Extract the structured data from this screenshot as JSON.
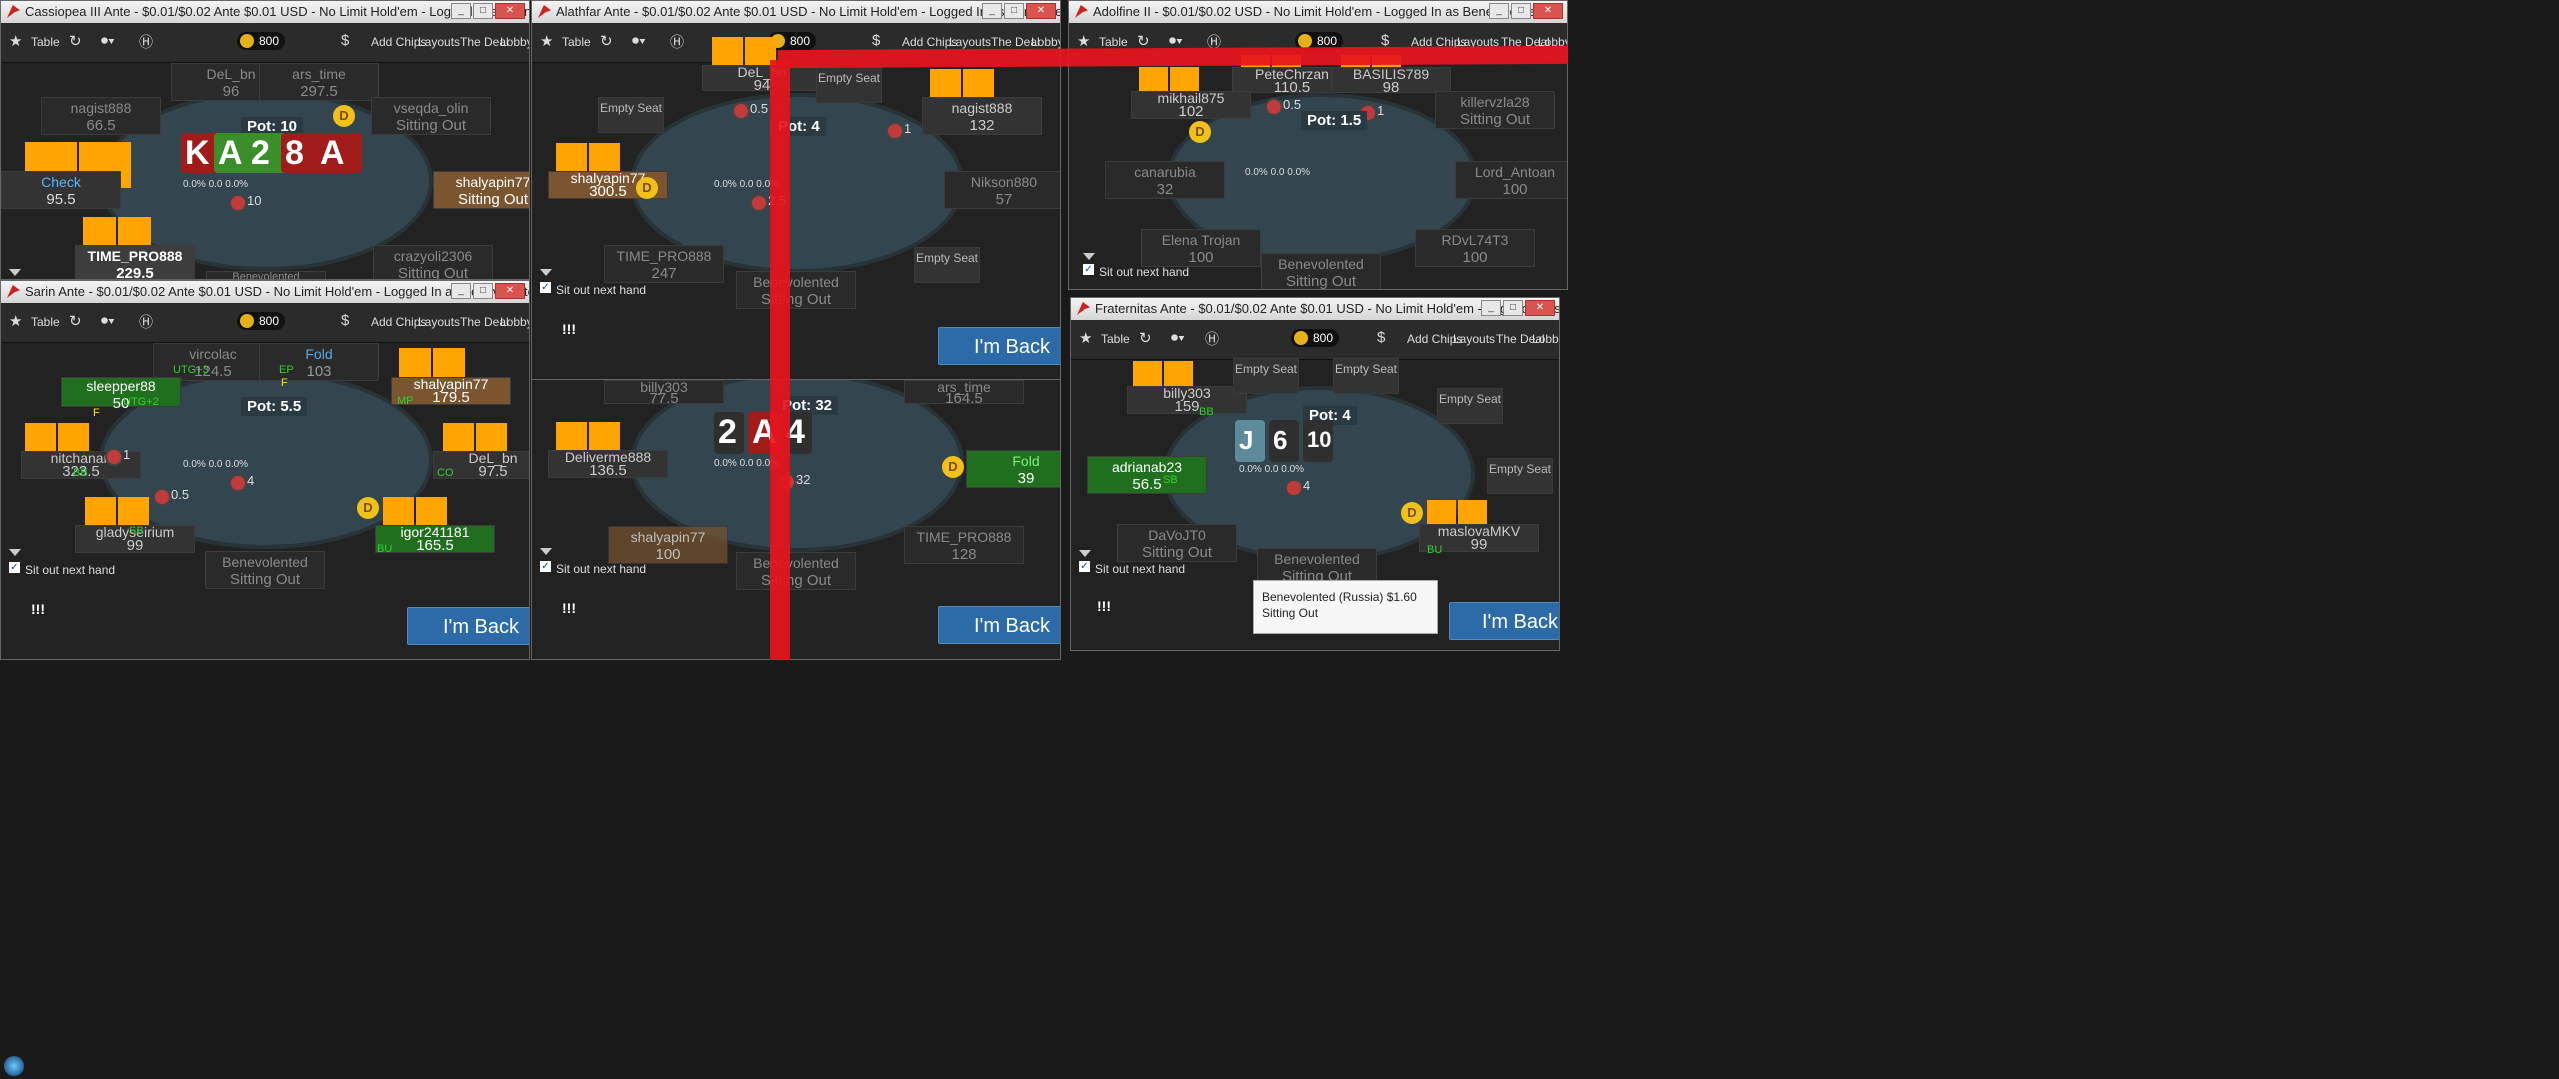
{
  "windows": [
    {
      "id": "w1",
      "title": "Cassiopea III Ante - $0.01/$0.02 Ante $0.01 USD - No Limit Hold'em - Logged In as Benevolented",
      "pot": "Pot: 10",
      "seats": [
        {
          "name": "DeL_bn",
          "stack": "96"
        },
        {
          "name": "ars_time",
          "stack": "297.5"
        },
        {
          "name": "nagist888",
          "stack": "66.5"
        },
        {
          "name": "vseqda_olin",
          "stack": "Sitting Out"
        },
        {
          "name": "Check",
          "stack": "95.5"
        },
        {
          "name": "shalyapin77",
          "stack": "Sitting Out"
        },
        {
          "name": "TIME_PRO888",
          "stack": "229.5"
        },
        {
          "name": "crazyoli2306",
          "stack": "Sitting Out"
        },
        {
          "name": "Benevolented",
          "stack": ""
        }
      ],
      "board": [
        "K",
        "A",
        "2",
        "8",
        "A"
      ],
      "betcenter": "10",
      "stats": "0.0% 0.0 0.0%"
    },
    {
      "id": "w2",
      "title": "Alathfar Ante - $0.01/$0.02 Ante $0.01 USD - No Limit Hold'em - Logged In as Benevolented",
      "pot": "Pot: 4",
      "seats": [
        {
          "name": "DeL_bn",
          "stack": "94"
        },
        {
          "name": "nagist888",
          "stack": "132"
        },
        {
          "name": "shalyapin77",
          "stack": "300.5"
        },
        {
          "name": "Nikson880",
          "stack": "57"
        },
        {
          "name": "TIME_PRO888",
          "stack": "247"
        },
        {
          "name": "Benevolented",
          "stack": "Sitting Out"
        }
      ],
      "empty": [
        "Empty Seat",
        "Empty Seat",
        "Empty Seat"
      ],
      "bets": [
        "0.5",
        "1",
        "2.5"
      ],
      "stats": "0.0% 0.0 0.0%",
      "sitout": "Sit out next hand",
      "imback": "I'm Back",
      "side": "!!!"
    },
    {
      "id": "w3",
      "title": "Adolfine II - $0.01/$0.02 USD - No Limit Hold'em - Logged In as Benevolented",
      "pot": "Pot: 1.5",
      "seats": [
        {
          "name": "PeteChrzan",
          "stack": "110.5"
        },
        {
          "name": "BASILIS789",
          "stack": "98"
        },
        {
          "name": "mikhail875",
          "stack": "102"
        },
        {
          "name": "killervzla28",
          "stack": "Sitting Out"
        },
        {
          "name": "canarubia",
          "stack": "32"
        },
        {
          "name": "Lord_Antoan",
          "stack": "100"
        },
        {
          "name": "Elena Trojan",
          "stack": "100"
        },
        {
          "name": "RDvL74T3",
          "stack": "100"
        },
        {
          "name": "Benevolented",
          "stack": "Sitting Out"
        }
      ],
      "bets": [
        "0.5",
        "1"
      ],
      "stats": "0.0% 0.0 0.0%",
      "sitout": "Sit out next hand"
    },
    {
      "id": "w4",
      "title": "Sarin Ante - $0.01/$0.02 Ante $0.01 USD - No Limit Hold'em - Logged In as Benevolented",
      "pot": "Pot: 5.5",
      "seats": [
        {
          "name": "vircolac",
          "stack": "124.5"
        },
        {
          "name": "Fold",
          "stack": "103"
        },
        {
          "name": "sleepper88",
          "stack": "50"
        },
        {
          "name": "shalyapin77",
          "stack": "179.5"
        },
        {
          "name": "nitchanan",
          "stack": "323.5"
        },
        {
          "name": "DeL_bn",
          "stack": "97.5"
        },
        {
          "name": "gladyseirium",
          "stack": "99"
        },
        {
          "name": "igor241181",
          "stack": "165.5"
        },
        {
          "name": "Benevolented",
          "stack": "Sitting Out"
        }
      ],
      "labels": [
        "UTG+3",
        "EP",
        "UTG+2",
        "MP",
        "BB",
        "CO",
        "SB",
        "BU",
        "F",
        "F",
        "F"
      ],
      "bets": [
        "1",
        "0.5",
        "4"
      ],
      "stats": "0.0% 0.0 0.0%",
      "sitout": "Sit out next hand",
      "imback": "I'm Back",
      "side": "!!!"
    },
    {
      "id": "w5",
      "title": "",
      "pot": "Pot: 32",
      "seats": [
        {
          "name": "billy303",
          "stack": "77.5"
        },
        {
          "name": "ars_time",
          "stack": "164.5"
        },
        {
          "name": "Deliverme888",
          "stack": "136.5"
        },
        {
          "name": "Fold",
          "stack": "39"
        },
        {
          "name": "shalyapin77",
          "stack": "100"
        },
        {
          "name": "TIME_PRO888",
          "stack": "128"
        },
        {
          "name": "Benevolented",
          "stack": "Sitting Out"
        }
      ],
      "board": [
        "2",
        "A",
        "4"
      ],
      "betcenter": "32",
      "stats": "0.0% 0.0 0.0%",
      "sitout": "Sit out next hand",
      "imback": "I'm Back",
      "side": "!!!"
    },
    {
      "id": "w6",
      "title": "Fraternitas Ante - $0.01/$0.02 Ante $0.01 USD - No Limit Hold'em - Logged In as Benevolented",
      "pot": "Pot: 4",
      "seats": [
        {
          "name": "billy303",
          "stack": "159"
        },
        {
          "name": "adrianab23",
          "stack": "56.5"
        },
        {
          "name": "DaVoJT0",
          "stack": "Sitting Out"
        },
        {
          "name": "maslovaMKV",
          "stack": "99"
        },
        {
          "name": "Benevolented",
          "stack": "Sitting Out"
        }
      ],
      "empty": [
        "Empty Seat",
        "Empty Seat",
        "Empty Seat",
        "Empty Seat"
      ],
      "board": [
        "J",
        "6",
        "10"
      ],
      "betcenter": "4",
      "stats": "0.0% 0.0 0.0%",
      "sitout": "Sit out next hand",
      "imback": "I'm Back",
      "side": "!!!",
      "labels": [
        "BB",
        "SB",
        "BU"
      ],
      "tooltip": {
        "line1": "Benevolented (Russia) $1.60",
        "line2": "Sitting Out"
      }
    }
  ],
  "toolbar": {
    "table": "Table",
    "chips": "800",
    "addchips": "Add Chips",
    "layouts": "Layouts",
    "deal": "The Deal",
    "lobby": "Lobby"
  },
  "dealer": "D",
  "colors": {
    "accent": "#2d6aa8",
    "felt": "#33454f",
    "holecards": "#ffa400",
    "annotation": "#e8141c"
  }
}
